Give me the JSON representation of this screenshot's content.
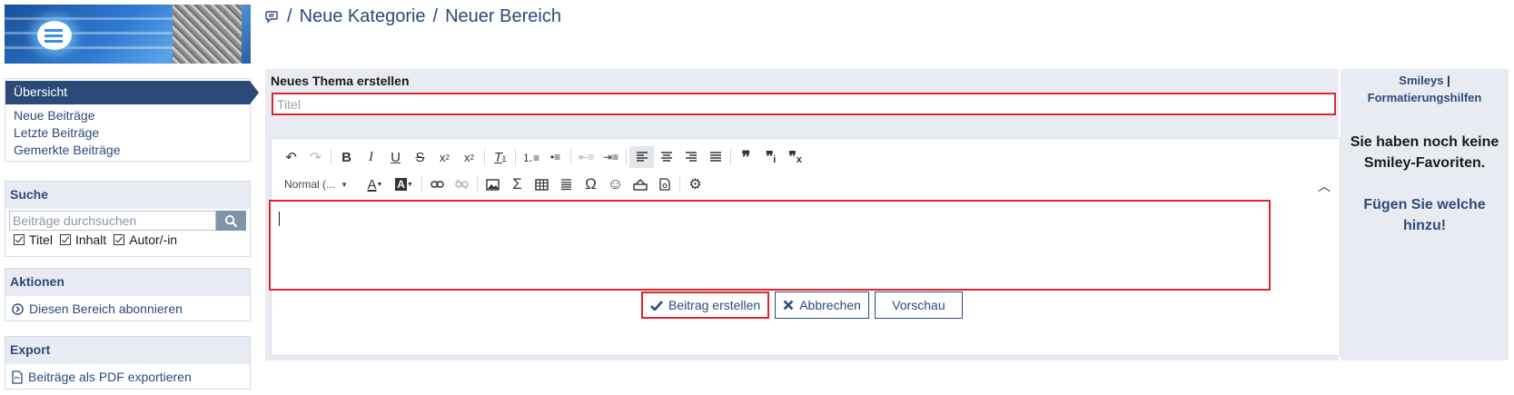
{
  "breadcrumb": {
    "category": "Neue Kategorie",
    "separator": "/",
    "area": "Neuer Bereich"
  },
  "sidebar": {
    "nav": {
      "active": "Übersicht",
      "items": [
        "Neue Beiträge",
        "Letzte Beiträge",
        "Gemerkte Beiträge"
      ]
    },
    "search": {
      "heading": "Suche",
      "placeholder": "Beiträge durchsuchen",
      "options": [
        "Titel",
        "Inhalt",
        "Autor/-in"
      ]
    },
    "actions": {
      "heading": "Aktionen",
      "subscribe": "Diesen Bereich abonnieren"
    },
    "export": {
      "heading": "Export",
      "pdf": "Beiträge als PDF exportieren"
    }
  },
  "main": {
    "heading": "Neues Thema erstellen",
    "title_placeholder": "Titel",
    "editor": {
      "format_select": "Normal (...",
      "toolbar_row1": [
        "undo",
        "redo",
        "bold",
        "italic",
        "underline",
        "strikethrough",
        "subscript",
        "superscript",
        "remove-format",
        "numbered-list",
        "bulleted-list",
        "outdent",
        "indent",
        "align-left",
        "align-center",
        "align-right",
        "justify",
        "blockquote",
        "quote-2",
        "quote-3"
      ],
      "toolbar_row2": [
        "text-color",
        "background-color",
        "link",
        "unlink",
        "image",
        "math-sigma",
        "table",
        "horizontal-line",
        "special-char-omega",
        "smiley",
        "spoiler",
        "template",
        "settings"
      ]
    },
    "buttons": {
      "submit": "Beitrag erstellen",
      "cancel": "Abbrechen",
      "preview": "Vorschau"
    }
  },
  "smileys": {
    "link_smileys": "Smileys",
    "pipe": "|",
    "link_help": "Formatierungshilfen",
    "empty_message": "Sie haben noch keine Smiley-Favoriten.",
    "add_message": "Fügen Sie welche hinzu!"
  },
  "colors": {
    "primary": "#2c4a78",
    "panel": "#e8ecf2",
    "highlight": "#d9262f"
  }
}
